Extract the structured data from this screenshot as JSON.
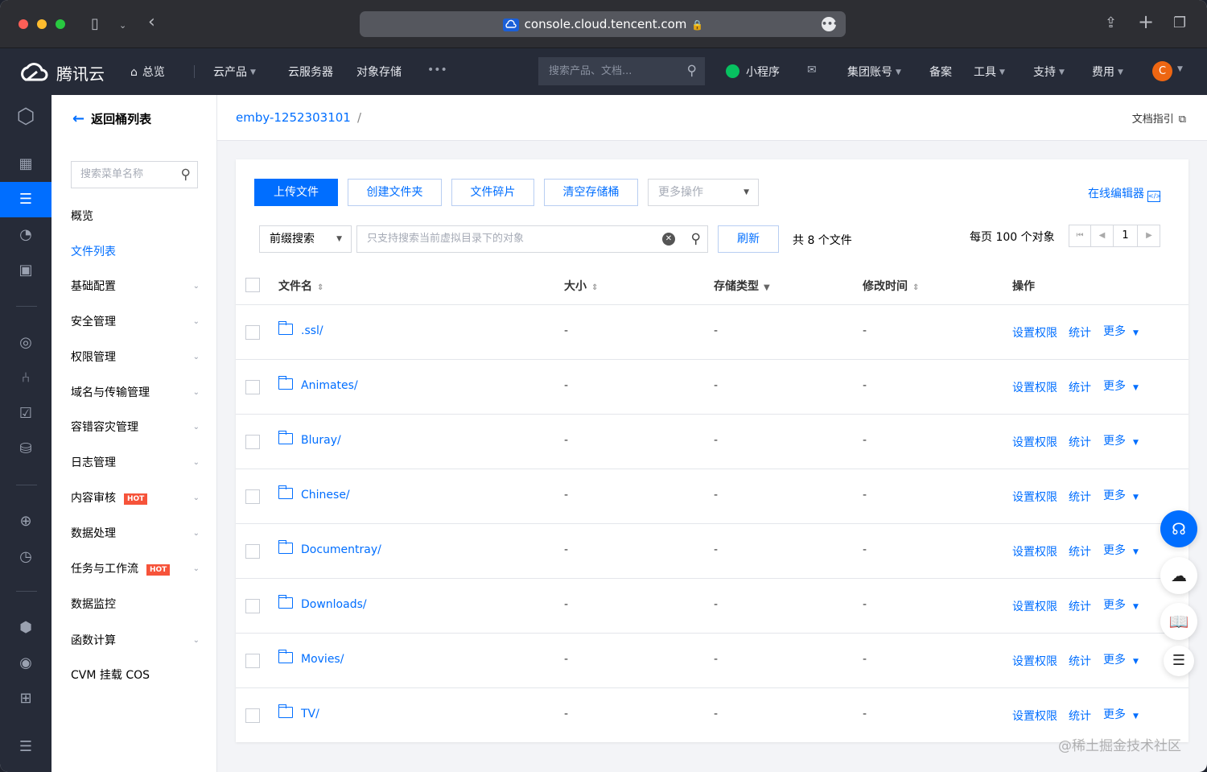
{
  "browser": {
    "url": "console.cloud.tencent.com",
    "lock_icon": "lock-icon",
    "menu_icon": "ellipsis-icon"
  },
  "topnav": {
    "brand": "腾讯云",
    "overview": "总览",
    "products": "云产品",
    "cvm": "云服务器",
    "cos": "对象存储",
    "more": "•••",
    "search_placeholder": "搜索产品、文档...",
    "miniprogram": "小程序",
    "group_account": "集团账号",
    "beian": "备案",
    "tools": "工具",
    "support": "支持",
    "billing": "费用",
    "avatar": "C"
  },
  "menu": {
    "back": "返回桶列表",
    "search_placeholder": "搜索菜单名称",
    "items": [
      {
        "label": "概览",
        "chevron": false,
        "hot": false
      },
      {
        "label": "文件列表",
        "chevron": false,
        "hot": false,
        "active": true
      },
      {
        "label": "基础配置",
        "chevron": true,
        "hot": false
      },
      {
        "label": "安全管理",
        "chevron": true,
        "hot": false
      },
      {
        "label": "权限管理",
        "chevron": true,
        "hot": false
      },
      {
        "label": "域名与传输管理",
        "chevron": true,
        "hot": false
      },
      {
        "label": "容错容灾管理",
        "chevron": true,
        "hot": false
      },
      {
        "label": "日志管理",
        "chevron": true,
        "hot": false
      },
      {
        "label": "内容审核",
        "chevron": true,
        "hot": true
      },
      {
        "label": "数据处理",
        "chevron": true,
        "hot": false
      },
      {
        "label": "任务与工作流",
        "chevron": true,
        "hot": true
      },
      {
        "label": "数据监控",
        "chevron": false,
        "hot": false
      },
      {
        "label": "函数计算",
        "chevron": true,
        "hot": false
      },
      {
        "label": "CVM 挂载 COS",
        "chevron": false,
        "hot": false
      }
    ],
    "hot_label": "HOT"
  },
  "header": {
    "bucket": "emby-1252303101",
    "sep": "/",
    "doc_guide": "文档指引"
  },
  "toolbar": {
    "upload": "上传文件",
    "create_folder": "创建文件夹",
    "fragments": "文件碎片",
    "clear_bucket": "清空存储桶",
    "more_ops": "更多操作",
    "online_editor": "在线编辑器",
    "prefix_search": "前缀搜索",
    "search_placeholder": "只支持搜索当前虚拟目录下的对象",
    "refresh": "刷新",
    "total": "共 8 个文件",
    "per_page": "每页 100 个对象",
    "page": "1"
  },
  "table": {
    "headers": {
      "name": "文件名",
      "size": "大小",
      "storage": "存储类型",
      "mtime": "修改时间",
      "ops": "操作"
    },
    "rows": [
      {
        "name": ".ssl/",
        "size": "-",
        "storage": "-",
        "mtime": "-"
      },
      {
        "name": "Animates/",
        "size": "-",
        "storage": "-",
        "mtime": "-"
      },
      {
        "name": "Bluray/",
        "size": "-",
        "storage": "-",
        "mtime": "-"
      },
      {
        "name": "Chinese/",
        "size": "-",
        "storage": "-",
        "mtime": "-"
      },
      {
        "name": "Documentray/",
        "size": "-",
        "storage": "-",
        "mtime": "-"
      },
      {
        "name": "Downloads/",
        "size": "-",
        "storage": "-",
        "mtime": "-"
      },
      {
        "name": "Movies/",
        "size": "-",
        "storage": "-",
        "mtime": "-"
      },
      {
        "name": "TV/",
        "size": "-",
        "storage": "-",
        "mtime": "-"
      }
    ],
    "op_perm": "设置权限",
    "op_stats": "统计",
    "op_more": "更多"
  },
  "watermark": "@稀土掘金技术社区",
  "colors": {
    "accent": "#006eff",
    "nav_bg": "#262b38",
    "hot": "#f6533a",
    "avatar": "#ee6612"
  }
}
